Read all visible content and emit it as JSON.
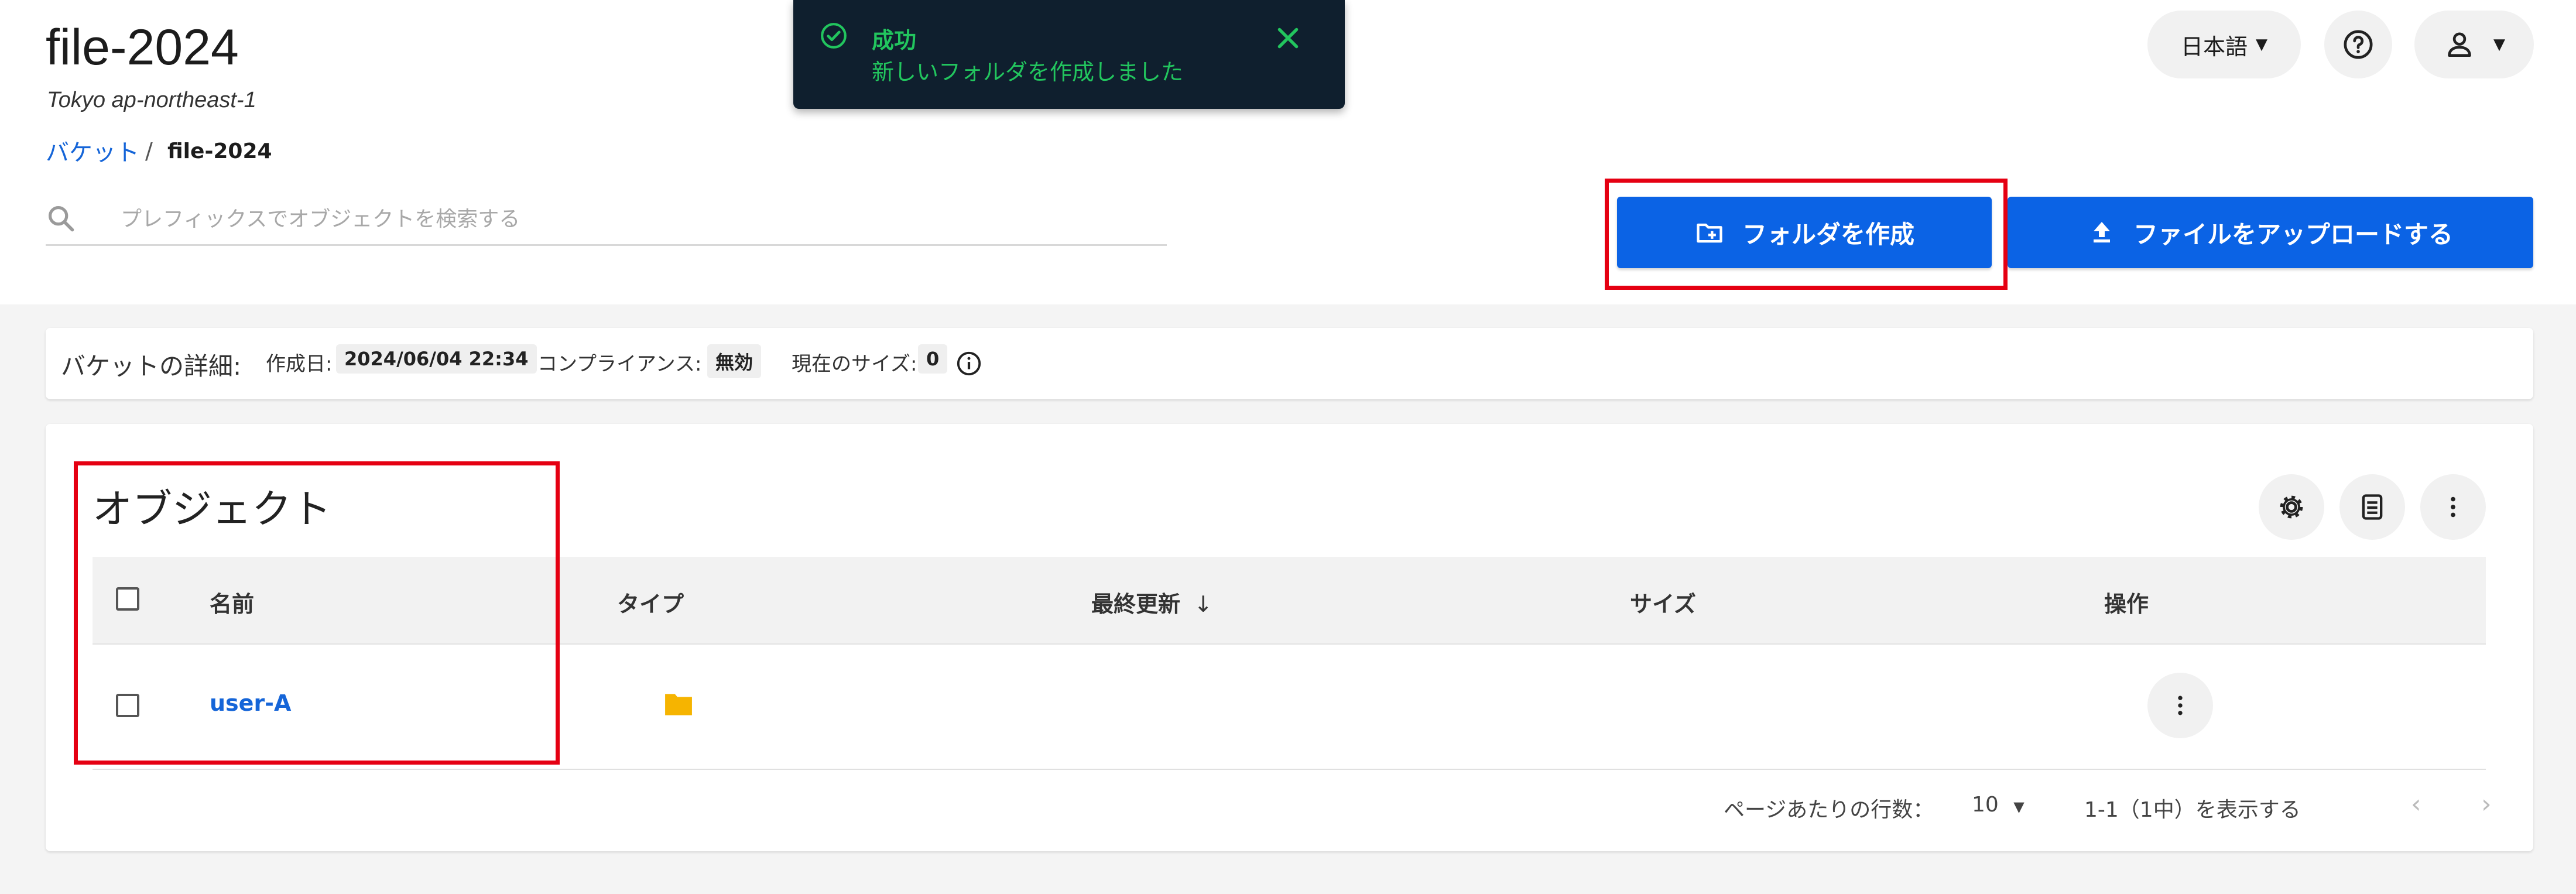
{
  "header": {
    "bucket_title": "file-2024",
    "region": "Tokyo ap-northeast-1",
    "breadcrumb": {
      "link": "バケット",
      "separator": "/",
      "current": "file-2024"
    },
    "search_placeholder": "プレフィックスでオブジェクトを検索する",
    "language": "日本語",
    "create_folder_label": "フォルダを作成",
    "upload_label": "ファイルをアップロードする"
  },
  "toast": {
    "title": "成功",
    "message": "新しいフォルダを作成しました",
    "color": "#22c55e"
  },
  "details": {
    "label": "バケットの詳細:",
    "created_label": "作成日:",
    "created_value": "2024/06/04 22:34",
    "compliance_label": "コンプライアンス:",
    "compliance_value": "無効",
    "size_label": "現在のサイズ:",
    "size_value": "0"
  },
  "objects": {
    "title": "オブジェクト",
    "columns": [
      "名前",
      "タイプ",
      "最終更新",
      "サイズ",
      "操作"
    ],
    "rows": [
      {
        "name": "user-A",
        "type_icon": "folder-icon",
        "last_modified": "",
        "size": ""
      }
    ],
    "footer": {
      "rows_per_page_label": "ページあたりの行数：",
      "rows_per_page": "10",
      "range": "1-1（1中）を表示する"
    }
  },
  "colors": {
    "primary": "#0b63e5",
    "link": "#1565d8",
    "highlight": "#e50012",
    "folder": "#f6b400"
  }
}
